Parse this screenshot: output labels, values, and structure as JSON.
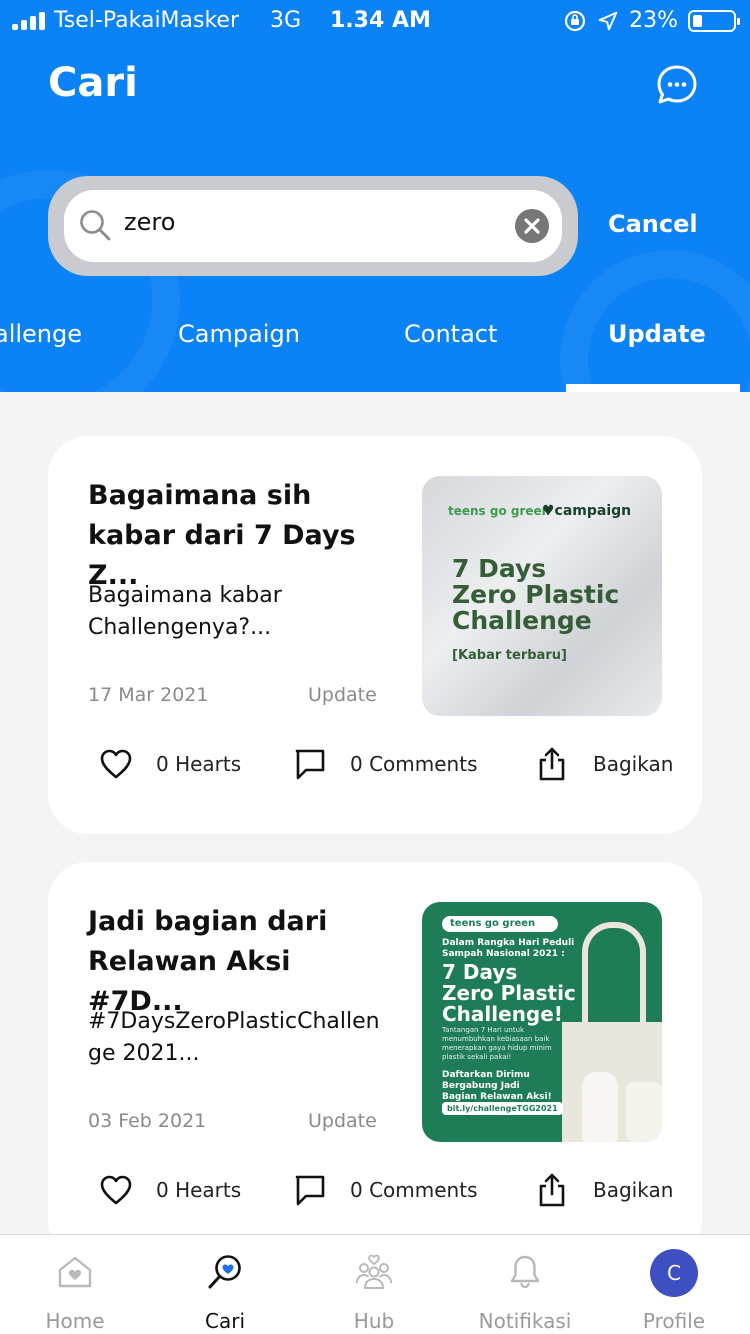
{
  "status_bar": {
    "carrier": "Tsel-PakaiMasker",
    "network": "3G",
    "time": "1.34 AM",
    "battery": "23%",
    "battery_level": 0.23
  },
  "header": {
    "title": "Cari",
    "chat_icon": "chat-bubble-icon"
  },
  "search": {
    "query": "zero",
    "cancel_label": "Cancel"
  },
  "tabs": [
    {
      "label": "allenge",
      "active": false
    },
    {
      "label": "Campaign",
      "active": false
    },
    {
      "label": "Contact",
      "active": false
    },
    {
      "label": "Update",
      "active": true
    }
  ],
  "cards": [
    {
      "title": "Bagaimana sih kabar dari 7 Days Z...",
      "snippet": "Bagaimana kabar Challengenya?...",
      "date": "17 Mar 2021",
      "category": "Update",
      "hearts": "0 Hearts",
      "comments": "0 Comments",
      "share": "Bagikan",
      "thumb": {
        "brand": "teens go green",
        "campaign": "♥campaign",
        "headline_1": "7 Days",
        "headline_2": "Zero Plastic",
        "headline_3": "Challenge",
        "sub": "[Kabar terbaru]"
      }
    },
    {
      "title": "Jadi bagian dari Relawan Aksi #7D...",
      "snippet": "#7DaysZeroPlasticChallenge 2021...",
      "date": "03 Feb 2021",
      "category": "Update",
      "hearts": "0 Hearts",
      "comments": "0 Comments",
      "share": "Bagikan",
      "thumb": {
        "brand": "teens go green ♥campaign",
        "pre_1": "Dalam Rangka Hari Peduli",
        "pre_2": "Sampah Nasional 2021 :",
        "headline_1": "7 Days",
        "headline_2": "Zero Plastic",
        "headline_3": "Challenge!",
        "desc": "Tantangan 7 Hari untuk menumbuhkan kebiasaan baik menerapkan gaya hidup minim plastik sekali pakai!",
        "cta_1": "Daftarkan Dirimu",
        "cta_2": "Bergabung Jadi",
        "cta_3": "Bagian Relawan Aksi!",
        "link": "bit.ly/challengeTGG2021"
      }
    }
  ],
  "bottom_nav": [
    {
      "label": "Home",
      "icon": "home-heart-icon",
      "active": false
    },
    {
      "label": "Cari",
      "icon": "search-heart-icon",
      "active": true
    },
    {
      "label": "Hub",
      "icon": "community-icon",
      "active": false
    },
    {
      "label": "Notifikasi",
      "icon": "bell-icon",
      "active": false
    },
    {
      "label": "Profile",
      "icon": "avatar",
      "active": false,
      "avatar_letter": "C"
    }
  ],
  "colors": {
    "primary": "#0b82f5",
    "accent_active": "#1f6fe5",
    "avatar_bg": "#3e4fc2",
    "muted_text": "#8a8a8a"
  }
}
